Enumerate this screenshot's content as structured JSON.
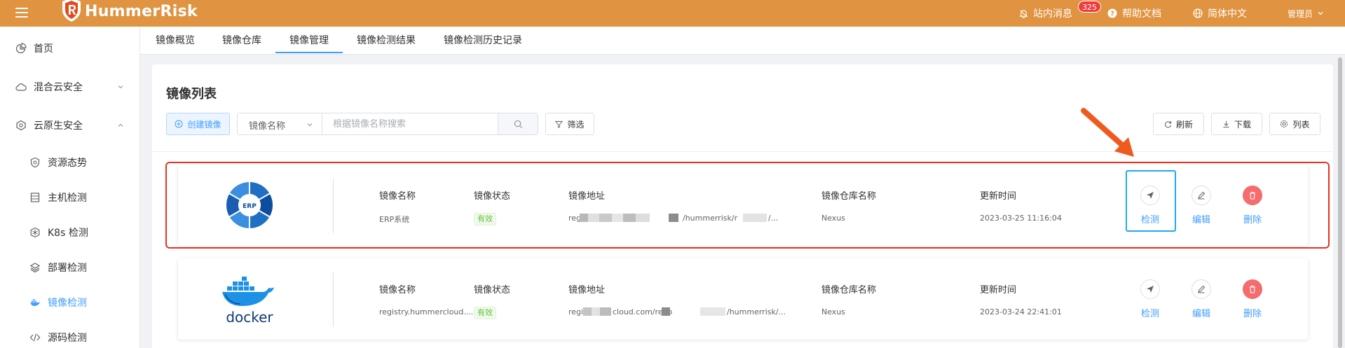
{
  "header": {
    "brand": "HummerRisk",
    "brand_color": "#e09340",
    "messages_label": "站内消息",
    "messages_count": "325",
    "help_label": "帮助文档",
    "language_label": "简体中文",
    "user_label": "管理员"
  },
  "sidebar": {
    "items": [
      {
        "label": "首页",
        "icon": "pie-chart-icon"
      },
      {
        "label": "混合云安全",
        "icon": "cloud-icon"
      },
      {
        "label": "云原生安全",
        "icon": "cloud-native-icon"
      }
    ],
    "sub_items": [
      {
        "label": "资源态势",
        "icon": "shield-icon"
      },
      {
        "label": "主机检测",
        "icon": "server-icon"
      },
      {
        "label": "K8s 检测",
        "icon": "k8s-icon"
      },
      {
        "label": "部署检测",
        "icon": "layers-icon"
      },
      {
        "label": "镜像检测",
        "icon": "docker-icon"
      },
      {
        "label": "源码检测",
        "icon": "code-icon"
      }
    ]
  },
  "tabs": [
    "镜像概览",
    "镜像仓库",
    "镜像管理",
    "镜像检测结果",
    "镜像检测历史记录"
  ],
  "active_tab": "镜像管理",
  "page": {
    "title": "镜像列表",
    "create_button": "创建镜像",
    "search_field_select": "镜像名称",
    "search_placeholder": "根据镜像名称搜索",
    "filter_button": "筛选",
    "refresh_button": "刷新",
    "download_button": "下载",
    "columns_button": "列表"
  },
  "columns": {
    "name": "镜像名称",
    "status": "镜像状态",
    "address": "镜像地址",
    "repo_name": "镜像仓库名称",
    "updated": "更新时间"
  },
  "rows": [
    {
      "logo": "ERP",
      "name": "ERP系统",
      "status": "有效",
      "address_prefix": "regi",
      "address_suffix": "/hummerrisk/r",
      "address_tail": "/...",
      "repo_name": "Nexus",
      "updated": "2023-03-25 11:16:04"
    },
    {
      "logo": "docker",
      "name": "registry.hummercloud....",
      "status": "有效",
      "address_prefix": "regis",
      "address_mid": "cloud.com/repo",
      "address_suffix": "/hummerrisk/...",
      "repo_name": "Nexus",
      "updated": "2023-03-24 22:41:01"
    }
  ],
  "actions": {
    "scan": "检测",
    "edit": "编辑",
    "delete": "删除"
  },
  "colors": {
    "primary": "#409eff",
    "danger": "#f56c6c",
    "success": "#67c23a",
    "highlight_red": "#e8321d",
    "highlight_blue": "#1eaaf1",
    "annotation_arrow": "#f05a1f"
  }
}
